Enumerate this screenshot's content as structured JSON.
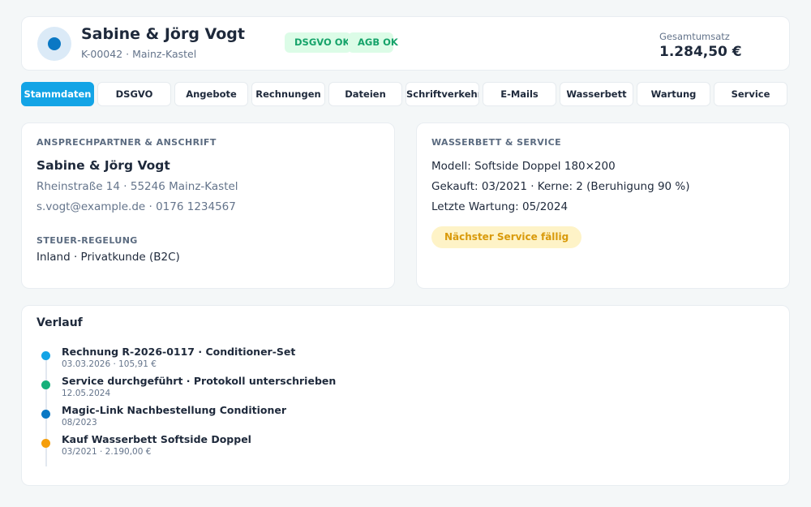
{
  "header": {
    "customer_name": "Sabine & Jörg Vogt",
    "customer_sub": "K-00042 · Mainz-Kastel",
    "badges": [
      "DSGVO OK",
      "AGB OK"
    ],
    "total_label": "Gesamtumsatz",
    "total_value": "1.284,50 €"
  },
  "tabs": [
    {
      "label": "Stammdaten",
      "active": true
    },
    {
      "label": "DSGVO",
      "active": false
    },
    {
      "label": "Angebote",
      "active": false
    },
    {
      "label": "Rechnungen",
      "active": false
    },
    {
      "label": "Dateien",
      "active": false
    },
    {
      "label": "Schriftverkehr",
      "active": false
    },
    {
      "label": "E-Mails",
      "active": false
    },
    {
      "label": "Wasserbett",
      "active": false
    },
    {
      "label": "Wartung",
      "active": false
    },
    {
      "label": "Service",
      "active": false
    }
  ],
  "contact": {
    "section_label": "ANSPRECHPARTNER & ANSCHRIFT",
    "name": "Sabine & Jörg Vogt",
    "address": "Rheinstraße 14 · 55246 Mainz-Kastel",
    "contact_line": "s.vogt@example.de · 0176 1234567",
    "tax_label": "STEUER-REGELUNG",
    "tax_value": "Inland · Privatkunde (B2C)"
  },
  "service": {
    "section_label": "WASSERBETT & SERVICE",
    "model": "Modell: Softside Doppel 180×200",
    "purchase": "Gekauft: 03/2021 · Kerne: 2 (Beruhigung 90 %)",
    "last_maintenance": "Letzte Wartung: 05/2024",
    "due_badge": "Nächster Service fällig"
  },
  "history": {
    "title": "Verlauf",
    "items": [
      {
        "title": "Rechnung R-2026-0117 · Conditioner-Set",
        "sub": "03.03.2026 · 105,91 €",
        "color": "#13a4e6"
      },
      {
        "title": "Service durchgeführt · Protokoll unterschrieben",
        "sub": "12.05.2024",
        "color": "#16b07a"
      },
      {
        "title": "Magic-Link Nachbestellung Conditioner",
        "sub": "08/2023",
        "color": "#0a78c4"
      },
      {
        "title": "Kauf Wasserbett Softside Doppel",
        "sub": "03/2021 · 2.190,00 €",
        "color": "#f59e0b"
      }
    ]
  },
  "colors": {
    "accent": "#13a4e6",
    "ok": "#16a36a",
    "warning": "#d99a0b"
  }
}
